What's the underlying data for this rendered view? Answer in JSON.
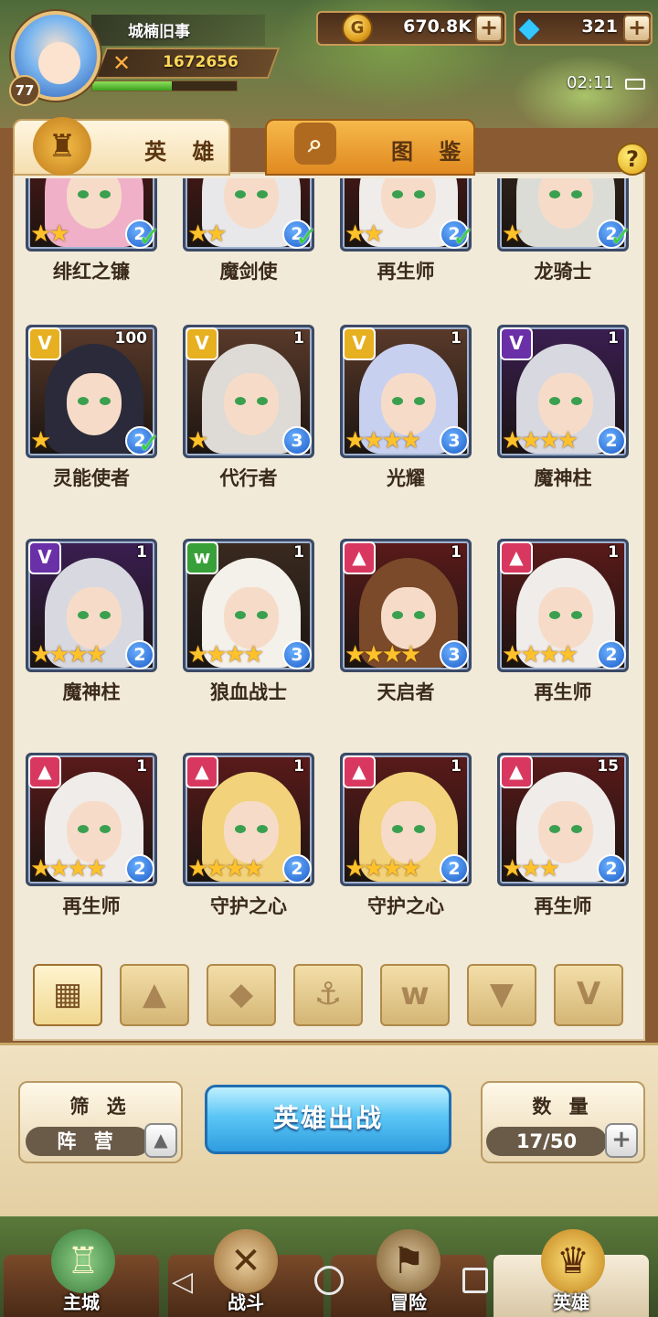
{
  "player": {
    "name": "城楠旧事",
    "level": "77",
    "power": "1672656",
    "exp_fraction": 0.55
  },
  "resources": {
    "gold": "670.8K",
    "gems": "321"
  },
  "status": {
    "time": "02:11"
  },
  "tabs": [
    {
      "label": "英 雄",
      "active": true
    },
    {
      "label": "图 鉴",
      "active": false
    }
  ],
  "help_label": "?",
  "icons": {
    "plus": "+",
    "check": "✓",
    "up": "▲",
    "faction_light": "V",
    "faction_dark": "V",
    "faction_beast": "w",
    "faction_fire": "▲",
    "filter_all": "▦",
    "filter_1": "▲",
    "filter_2": "◆",
    "filter_3": "⚓",
    "filter_4": "w",
    "filter_5": "▼",
    "filter_6": "V",
    "back": "◁"
  },
  "heroes": [
    {
      "name": "绯红之镰",
      "stars": "★★",
      "grade": "2",
      "count": "",
      "faction": "fire",
      "check": true,
      "hair": "#f0b0c8"
    },
    {
      "name": "魔剑使",
      "stars": "★★",
      "grade": "2",
      "count": "",
      "faction": "fire",
      "check": true,
      "hair": "#e8e8ea"
    },
    {
      "name": "再生师",
      "stars": "★★",
      "grade": "2",
      "count": "",
      "faction": "fire",
      "check": true,
      "hair": "#f0ecea"
    },
    {
      "name": "龙骑士",
      "stars": "★",
      "grade": "2",
      "count": "",
      "faction": "beast",
      "check": true,
      "hair": "#dcdcd6"
    },
    {
      "name": "灵能使者",
      "stars": "★",
      "grade": "2",
      "count": "100",
      "faction": "light",
      "check": true,
      "hair": "#2a2a3a"
    },
    {
      "name": "代行者",
      "stars": "★",
      "grade": "3",
      "count": "1",
      "faction": "light",
      "check": false,
      "hair": "#dedad6"
    },
    {
      "name": "光耀",
      "stars": "★★★★",
      "grade": "3",
      "count": "1",
      "faction": "light",
      "check": false,
      "hair": "#c8d0f0"
    },
    {
      "name": "魔神柱",
      "stars": "★★★★",
      "grade": "2",
      "count": "1",
      "faction": "dark",
      "check": false,
      "hair": "#d8d8e0"
    },
    {
      "name": "魔神柱",
      "stars": "★★★★",
      "grade": "2",
      "count": "1",
      "faction": "dark",
      "check": false,
      "hair": "#d8d8e0"
    },
    {
      "name": "狼血战士",
      "stars": "★★★★",
      "grade": "3",
      "count": "1",
      "faction": "beast",
      "check": false,
      "hair": "#f4f0ea"
    },
    {
      "name": "天启者",
      "stars": "★★★★",
      "grade": "3",
      "count": "1",
      "faction": "fire",
      "check": false,
      "hair": "#7a4a2a"
    },
    {
      "name": "再生师",
      "stars": "★★★★",
      "grade": "2",
      "count": "1",
      "faction": "fire",
      "check": false,
      "hair": "#f0ecea"
    },
    {
      "name": "再生师",
      "stars": "★★★★",
      "grade": "2",
      "count": "1",
      "faction": "fire",
      "check": false,
      "hair": "#f0ecea"
    },
    {
      "name": "守护之心",
      "stars": "★★★★",
      "grade": "2",
      "count": "1",
      "faction": "fire",
      "check": false,
      "hair": "#f2d27a"
    },
    {
      "name": "守护之心",
      "stars": "★★★★",
      "grade": "2",
      "count": "1",
      "faction": "fire",
      "check": false,
      "hair": "#f2d27a"
    },
    {
      "name": "再生师",
      "stars": "★★★",
      "grade": "2",
      "count": "15",
      "faction": "fire",
      "check": false,
      "hair": "#f0ecea"
    }
  ],
  "bottom": {
    "filter_title": "筛 选",
    "filter_value": "阵 营",
    "deploy_label": "英雄出战",
    "count_title": "数 量",
    "count_value": "17/50"
  },
  "nav": [
    {
      "label": "主城",
      "active": false
    },
    {
      "label": "战斗",
      "active": false
    },
    {
      "label": "冒险",
      "active": false
    },
    {
      "label": "英雄",
      "active": true
    }
  ],
  "colors": {
    "faction_light": "#e6b020",
    "faction_dark": "#6a30a8",
    "faction_beast": "#38a038",
    "faction_fire": "#d83860"
  }
}
